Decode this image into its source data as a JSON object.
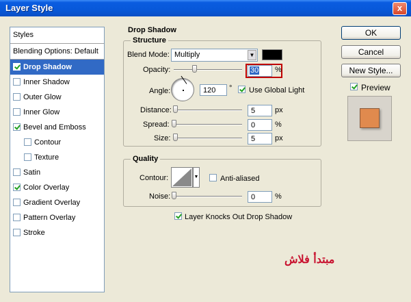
{
  "window": {
    "title": "Layer Style",
    "close_glyph": "x"
  },
  "styles_list": {
    "header": "Styles",
    "items": [
      {
        "label": "Blending Options: Default",
        "checkbox": false,
        "checked": false,
        "selected": false,
        "indent": false
      },
      {
        "label": "Drop Shadow",
        "checkbox": true,
        "checked": true,
        "selected": true,
        "indent": false
      },
      {
        "label": "Inner Shadow",
        "checkbox": true,
        "checked": false,
        "selected": false,
        "indent": false
      },
      {
        "label": "Outer Glow",
        "checkbox": true,
        "checked": false,
        "selected": false,
        "indent": false
      },
      {
        "label": "Inner Glow",
        "checkbox": true,
        "checked": false,
        "selected": false,
        "indent": false
      },
      {
        "label": "Bevel and Emboss",
        "checkbox": true,
        "checked": true,
        "selected": false,
        "indent": false
      },
      {
        "label": "Contour",
        "checkbox": true,
        "checked": false,
        "selected": false,
        "indent": true
      },
      {
        "label": "Texture",
        "checkbox": true,
        "checked": false,
        "selected": false,
        "indent": true
      },
      {
        "label": "Satin",
        "checkbox": true,
        "checked": false,
        "selected": false,
        "indent": false
      },
      {
        "label": "Color Overlay",
        "checkbox": true,
        "checked": true,
        "selected": false,
        "indent": false
      },
      {
        "label": "Gradient Overlay",
        "checkbox": true,
        "checked": false,
        "selected": false,
        "indent": false
      },
      {
        "label": "Pattern Overlay",
        "checkbox": true,
        "checked": false,
        "selected": false,
        "indent": false
      },
      {
        "label": "Stroke",
        "checkbox": true,
        "checked": false,
        "selected": false,
        "indent": false
      }
    ]
  },
  "drop_shadow": {
    "title": "Drop Shadow",
    "structure": {
      "title": "Structure",
      "blend_mode_label": "Blend Mode:",
      "blend_mode_value": "Multiply",
      "shadow_color": "#000000",
      "opacity_label": "Opacity:",
      "opacity_value": "30",
      "opacity_unit": "%",
      "opacity_level": 0.3,
      "angle_label": "Angle:",
      "angle_value": "120",
      "angle_unit": "°",
      "use_global_light_label": "Use Global Light",
      "use_global_light_checked": true,
      "distance_label": "Distance:",
      "distance_value": "5",
      "distance_unit": "px",
      "distance_level": 0.02,
      "spread_label": "Spread:",
      "spread_value": "0",
      "spread_unit": "%",
      "spread_level": 0,
      "size_label": "Size:",
      "size_value": "5",
      "size_unit": "px",
      "size_level": 0.02
    },
    "quality": {
      "title": "Quality",
      "contour_label": "Contour:",
      "anti_aliased_label": "Anti-aliased",
      "anti_aliased_checked": false,
      "noise_label": "Noise:",
      "noise_value": "0",
      "noise_unit": "%",
      "noise_level": 0
    },
    "knocks_out_label": "Layer Knocks Out Drop Shadow",
    "knocks_out_checked": true
  },
  "buttons": {
    "ok": "OK",
    "cancel": "Cancel",
    "new_style": "New Style..."
  },
  "preview": {
    "label": "Preview",
    "checked": true,
    "swatch_color": "#e08a4e"
  },
  "watermark": "مبتدأ فلاش"
}
